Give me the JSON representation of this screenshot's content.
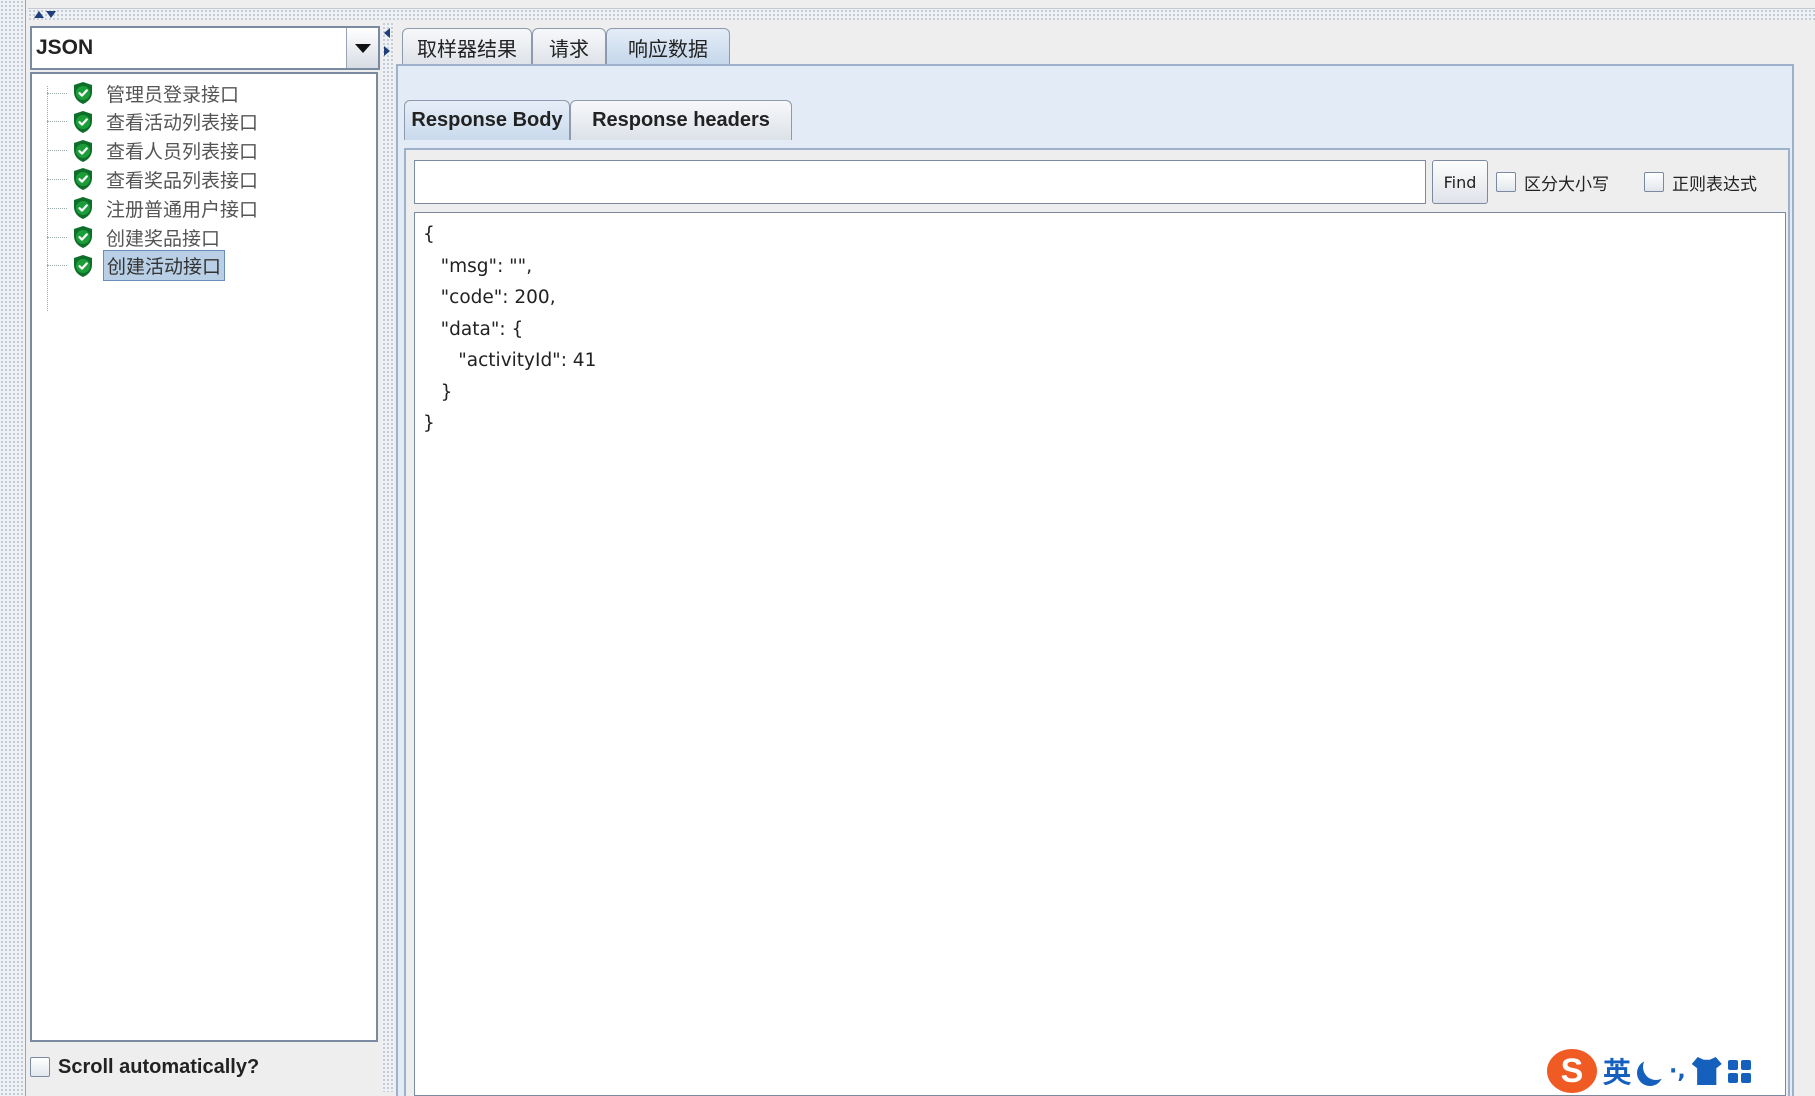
{
  "left_panel": {
    "renderer_value": "JSON",
    "tree_items": [
      {
        "label": "管理员登录接口",
        "status": "success"
      },
      {
        "label": "查看活动列表接口",
        "status": "success"
      },
      {
        "label": "查看人员列表接口",
        "status": "success"
      },
      {
        "label": "查看奖品列表接口",
        "status": "success"
      },
      {
        "label": "注册普通用户接口",
        "status": "success"
      },
      {
        "label": "创建奖品接口",
        "status": "success"
      },
      {
        "label": "创建活动接口",
        "status": "success",
        "selected": true
      }
    ],
    "scroll_auto_label": "Scroll automatically?"
  },
  "tabs": [
    "取样器结果",
    "请求",
    "响应数据"
  ],
  "active_tab": "响应数据",
  "sub_tabs": [
    "Response Body",
    "Response headers"
  ],
  "active_sub_tab": "Response Body",
  "search": {
    "placeholder": "",
    "find_label": "Find",
    "case_label": "区分大小写",
    "regex_label": "正则表达式"
  },
  "response_body": "{\n   \"msg\": \"\",\n   \"code\": 200,\n   \"data\": {\n      \"activityId\": 41\n   }\n}",
  "ime": {
    "logo": "S",
    "mode": "英",
    "punct": "·,"
  },
  "colors": {
    "success": "#1b9e3a",
    "accent": "#1560bd",
    "selection": "#b8cfe5",
    "ime_logo": "#f05a23"
  }
}
